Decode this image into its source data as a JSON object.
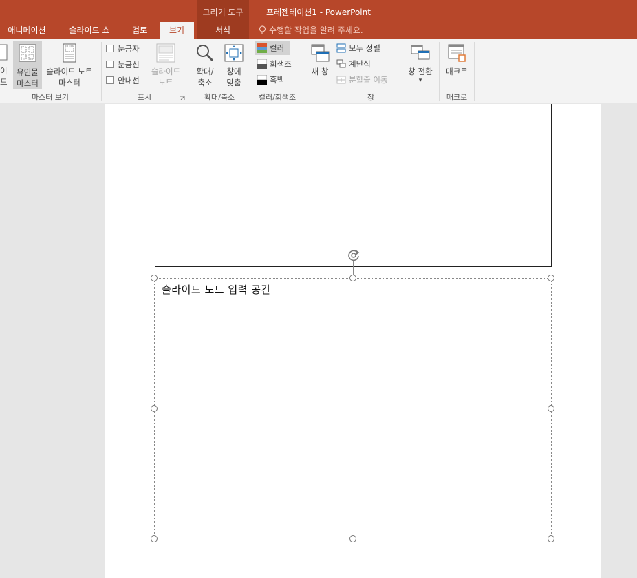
{
  "window": {
    "title": "프레젠테이션1 - PowerPoint",
    "context_tab_group": "그리기 도구"
  },
  "tabs": [
    {
      "label": "애니메이션"
    },
    {
      "label": "슬라이드 쇼"
    },
    {
      "label": "검토"
    },
    {
      "label": "보기",
      "active": true
    },
    {
      "label": "서식"
    }
  ],
  "tell_me": "수행할 작업을 알려 주세요.",
  "ribbon": {
    "master_views": {
      "group_label": "마스터 보기",
      "slide_master_partial_1": "이드",
      "slide_master_partial_2": "터",
      "handout_master_1": "유인물",
      "handout_master_2": "마스터",
      "notes_master_1": "슬라이드 노트",
      "notes_master_2": "마스터"
    },
    "show": {
      "group_label": "표시",
      "ruler": "눈금자",
      "gridlines": "눈금선",
      "guides": "안내선",
      "notes_1": "슬라이드",
      "notes_2": "노트"
    },
    "zoom": {
      "group_label": "확대/축소",
      "zoom_1": "확대/",
      "zoom_2": "축소",
      "fit_1": "창에",
      "fit_2": "맞춤"
    },
    "color": {
      "group_label": "컬러/회색조",
      "color": "컬러",
      "grayscale": "회색조",
      "black_white": "흑백"
    },
    "window": {
      "group_label": "창",
      "new_window_1": "새 창",
      "arrange_all": "모두 정렬",
      "cascade": "계단식",
      "move_split": "분할줄 이동",
      "switch_1": "창 전환",
      "switch_2": "▾"
    },
    "macros": {
      "group_label": "매크로",
      "macros": "매크로"
    }
  },
  "notes": {
    "text": "슬라이드 노트 입력 공간"
  },
  "colors": {
    "accent": "#b7472a",
    "accent_dark": "#9e3b20",
    "ribbon_bg": "#f3f3f3"
  }
}
